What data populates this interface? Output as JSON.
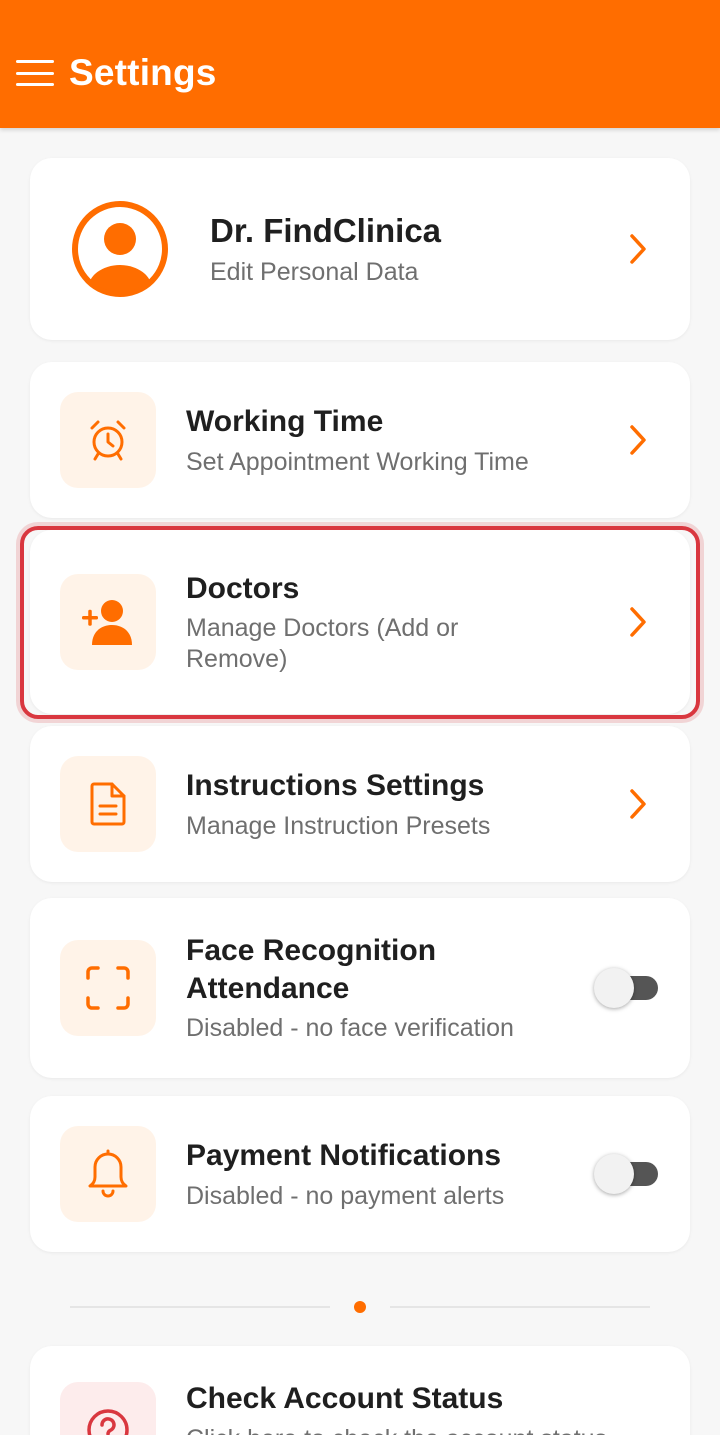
{
  "colors": {
    "brand": "#ff6d00",
    "highlight": "#d9373f",
    "icon_bg": "#fff3e8"
  },
  "header": {
    "title": "Settings",
    "menu_icon": "hamburger-menu-icon"
  },
  "profile": {
    "name": "Dr. FindClinica",
    "subtitle": "Edit Personal Data"
  },
  "items": [
    {
      "title": "Working Time",
      "subtitle": "Set Appointment Working Time",
      "icon": "alarm-clock-icon",
      "control": "chevron"
    },
    {
      "title": "Doctors",
      "subtitle": "Manage Doctors (Add or Remove)",
      "icon": "add-user-icon",
      "control": "chevron",
      "highlighted": true
    },
    {
      "title": "Instructions Settings",
      "subtitle": "Manage Instruction Presets",
      "icon": "document-icon",
      "control": "chevron"
    },
    {
      "title": "Face Recognition Attendance",
      "subtitle": "Disabled - no face verification",
      "icon": "face-scan-icon",
      "control": "toggle",
      "enabled": false
    },
    {
      "title": "Payment Notifications",
      "subtitle": "Disabled - no payment alerts",
      "icon": "bell-icon",
      "control": "toggle",
      "enabled": false
    }
  ],
  "account_status": {
    "title": "Check Account Status",
    "subtitle": "Click here to check the account status",
    "icon": "help-circle-icon"
  }
}
